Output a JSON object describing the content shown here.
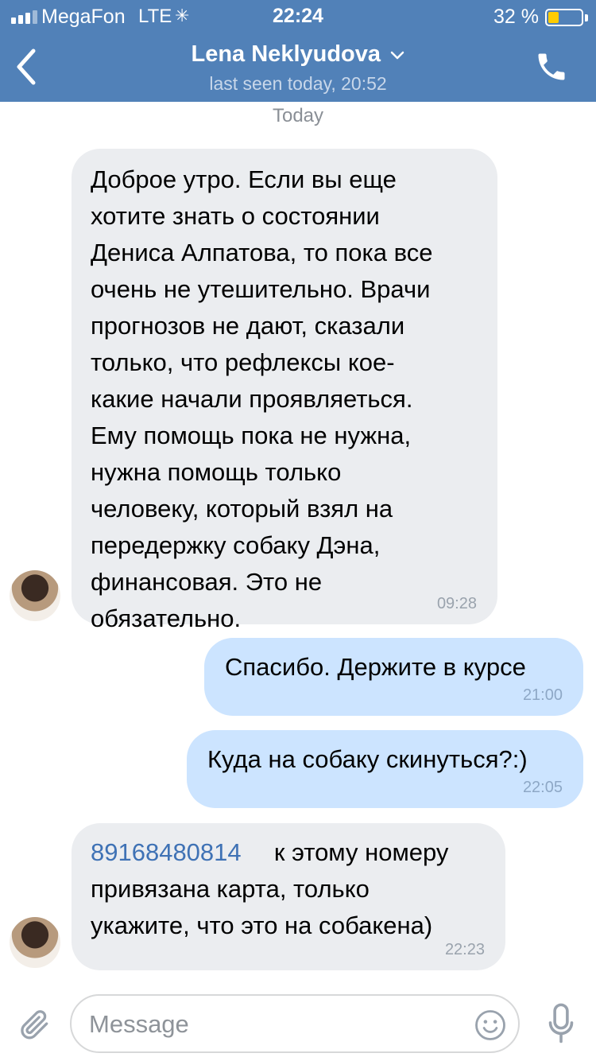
{
  "status_bar": {
    "carrier": "MegaFon",
    "network": "LTE",
    "activity_icon": "loading-spinner-icon",
    "time": "22:24",
    "battery_percent": "32 %",
    "battery_level": 0.32,
    "battery_color": "#ffcc00"
  },
  "header": {
    "contact_name": "Lena Neklyudova",
    "last_seen": "last seen today, 20:52",
    "back_icon": "chevron-left-icon",
    "call_icon": "phone-icon",
    "background_color": "#5181b8"
  },
  "chat": {
    "date_separator": "Today",
    "messages": [
      {
        "direction": "incoming",
        "text": "Доброе утро. Если вы еще\nхотите знать о состоянии\nДениса Алпатова, то пока все\nочень не утешительно. Врачи\nпрогнозов не дают, сказали\nтолько, что рефлексы кое-\nкакие начали проявляеться.\nЕму помощь пока не нужна,\nнужна помощь только\nчеловеку, который взял на\nпередержку собаку Дэна,\nфинансовая. Это не\nобязательно.",
        "time": "09:28"
      },
      {
        "direction": "outgoing",
        "text": "Спасибо. Держите в курсе",
        "time": "21:00"
      },
      {
        "direction": "outgoing",
        "text": "Куда на собаку скинуться?:)",
        "time": "22:05"
      },
      {
        "direction": "incoming",
        "phone_link": "89168480814",
        "text_after_link": "к этому номеру",
        "text": "привязана карта, только\nукажите, что это на собакена)",
        "time": "22:23"
      }
    ],
    "incoming_bubble_color": "#ebedf0",
    "outgoing_bubble_color": "#cce4ff"
  },
  "input": {
    "placeholder": "Message",
    "attach_icon": "paperclip-icon",
    "emoji_icon": "smiley-icon",
    "mic_icon": "microphone-icon"
  }
}
